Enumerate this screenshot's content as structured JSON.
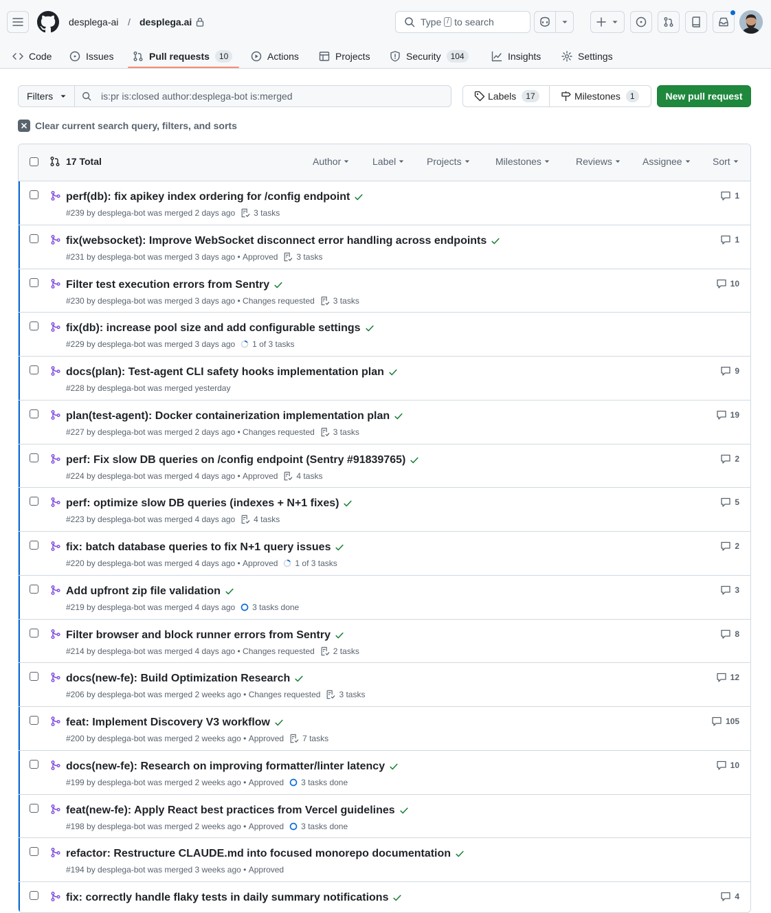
{
  "header": {
    "owner": "desplega-ai",
    "separator": "/",
    "repo": "desplega.ai",
    "search_prefix": "Type",
    "search_key": "/",
    "search_suffix": "to search"
  },
  "nav": {
    "code": "Code",
    "issues": "Issues",
    "pull_requests": "Pull requests",
    "pull_requests_count": "10",
    "actions": "Actions",
    "projects": "Projects",
    "security": "Security",
    "security_count": "104",
    "insights": "Insights",
    "settings": "Settings"
  },
  "toolbar": {
    "filters_label": "Filters",
    "query": "is:pr is:closed author:desplega-bot is:merged",
    "labels_label": "Labels",
    "labels_count": "17",
    "milestones_label": "Milestones",
    "milestones_count": "1",
    "new_pr_label": "New pull request",
    "clear_label": "Clear current search query, filters, and sorts"
  },
  "list_header": {
    "total": "17 Total",
    "filters": [
      "Author",
      "Label",
      "Projects",
      "Milestones",
      "Reviews",
      "Assignee",
      "Sort"
    ]
  },
  "colors": {
    "accent": "#0969da",
    "merged": "#8250df",
    "success": "#1a7f37",
    "primary_button": "#1f883d",
    "nav_underline": "#fd8c73"
  },
  "pull_requests": [
    {
      "title": "perf(db): fix apikey index ordering for /config endpoint",
      "meta": "#239 by desplega-bot was merged 2 days ago",
      "review": "",
      "tasks": "3 tasks",
      "task_type": "list",
      "comments": "1"
    },
    {
      "title": "fix(websocket): Improve WebSocket disconnect error handling across endpoints",
      "meta": "#231 by desplega-bot was merged 3 days ago",
      "review": "Approved",
      "tasks": "3 tasks",
      "task_type": "list",
      "comments": "1"
    },
    {
      "title": "Filter test execution errors from Sentry",
      "meta": "#230 by desplega-bot was merged 3 days ago",
      "review": "Changes requested",
      "tasks": "3 tasks",
      "task_type": "list",
      "comments": "10"
    },
    {
      "title": "fix(db): increase pool size and add configurable settings",
      "meta": "#229 by desplega-bot was merged 3 days ago",
      "review": "",
      "tasks": "1 of 3 tasks",
      "task_type": "partial",
      "comments": ""
    },
    {
      "title": "docs(plan): Test-agent CLI safety hooks implementation plan",
      "meta": "#228 by desplega-bot was merged yesterday",
      "review": "",
      "tasks": "",
      "task_type": "none",
      "comments": "9"
    },
    {
      "title": "plan(test-agent): Docker containerization implementation plan",
      "meta": "#227 by desplega-bot was merged 2 days ago",
      "review": "Changes requested",
      "tasks": "3 tasks",
      "task_type": "list",
      "comments": "19"
    },
    {
      "title": "perf: Fix slow DB queries on /config endpoint (Sentry #91839765)",
      "meta": "#224 by desplega-bot was merged 4 days ago",
      "review": "Approved",
      "tasks": "4 tasks",
      "task_type": "list",
      "comments": "2"
    },
    {
      "title": "perf: optimize slow DB queries (indexes + N+1 fixes)",
      "meta": "#223 by desplega-bot was merged 4 days ago",
      "review": "",
      "tasks": "4 tasks",
      "task_type": "list",
      "comments": "5"
    },
    {
      "title": "fix: batch database queries to fix N+1 query issues",
      "meta": "#220 by desplega-bot was merged 4 days ago",
      "review": "Approved",
      "tasks": "1 of 3 tasks",
      "task_type": "partial",
      "comments": "2"
    },
    {
      "title": "Add upfront zip file validation",
      "meta": "#219 by desplega-bot was merged 4 days ago",
      "review": "",
      "tasks": "3 tasks done",
      "task_type": "done",
      "comments": "3"
    },
    {
      "title": "Filter browser and block runner errors from Sentry",
      "meta": "#214 by desplega-bot was merged 4 days ago",
      "review": "Changes requested",
      "tasks": "2 tasks",
      "task_type": "list",
      "comments": "8"
    },
    {
      "title": "docs(new-fe): Build Optimization Research",
      "meta": "#206 by desplega-bot was merged 2 weeks ago",
      "review": "Changes requested",
      "tasks": "3 tasks",
      "task_type": "list",
      "comments": "12"
    },
    {
      "title": "feat: Implement Discovery V3 workflow",
      "meta": "#200 by desplega-bot was merged 2 weeks ago",
      "review": "Approved",
      "tasks": "7 tasks",
      "task_type": "list",
      "comments": "105"
    },
    {
      "title": "docs(new-fe): Research on improving formatter/linter latency",
      "meta": "#199 by desplega-bot was merged 2 weeks ago",
      "review": "Approved",
      "tasks": "3 tasks done",
      "task_type": "done",
      "comments": "10"
    },
    {
      "title": "feat(new-fe): Apply React best practices from Vercel guidelines",
      "meta": "#198 by desplega-bot was merged 2 weeks ago",
      "review": "Approved",
      "tasks": "3 tasks done",
      "task_type": "done",
      "comments": ""
    },
    {
      "title": "refactor: Restructure CLAUDE.md into focused monorepo documentation",
      "meta": "#194 by desplega-bot was merged 3 weeks ago",
      "review": "Approved",
      "tasks": "",
      "task_type": "none",
      "comments": ""
    },
    {
      "title": "fix: correctly handle flaky tests in daily summary notifications",
      "meta": "",
      "review": "",
      "tasks": "",
      "task_type": "none",
      "comments": "4"
    }
  ]
}
